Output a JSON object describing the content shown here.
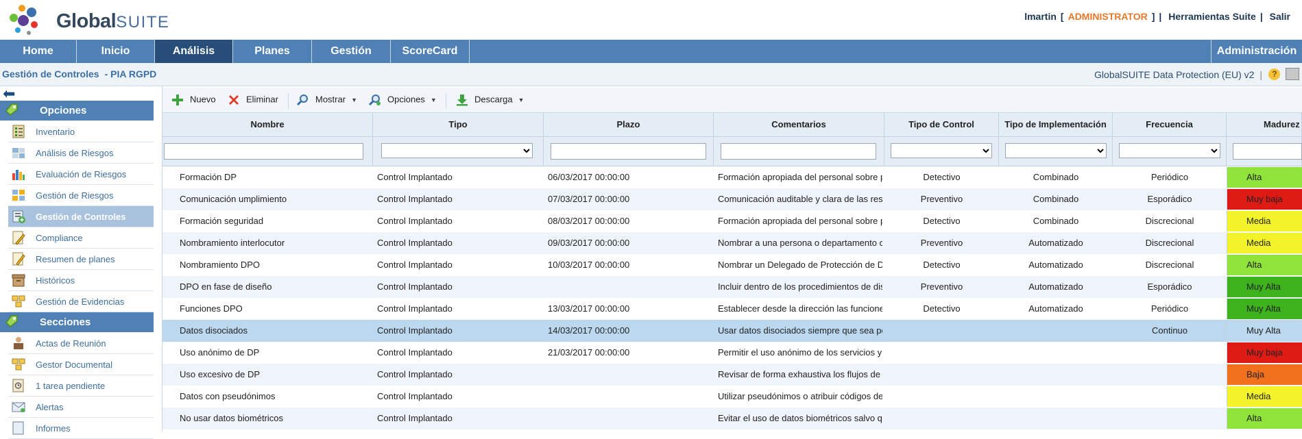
{
  "header": {
    "logo_main": "Global",
    "logo_suite": "SUITE",
    "user": "lmartin",
    "role": "ADMINISTRATOR",
    "tools_label": "Herramientas Suite",
    "exit_label": "Salir"
  },
  "nav": {
    "items": [
      "Home",
      "Inicio",
      "Análisis",
      "Planes",
      "Gestión",
      "ScoreCard"
    ],
    "active": "Análisis",
    "admin": "Administración"
  },
  "subheader": {
    "title": "Gestión de Controles",
    "context": "- PIA RGPD",
    "product": "GlobalSUITE Data Protection (EU) v2",
    "help": "?"
  },
  "sidebar": {
    "opciones_label": "Opciones",
    "opciones_items": [
      "Inventario",
      "Análisis de Riesgos",
      "Evaluación de Riesgos",
      "Gestión de Riesgos",
      "Gestión de Controles",
      "Compliance",
      "Resumen de planes",
      "Históricos",
      "Gestión de Evidencias"
    ],
    "active_item": "Gestión de Controles",
    "secciones_label": "Secciones",
    "secciones_items": [
      "Actas de Reunión",
      "Gestor Documental",
      "1 tarea pendiente",
      "Alertas",
      "Informes"
    ]
  },
  "toolbar": {
    "nuevo": "Nuevo",
    "eliminar": "Eliminar",
    "mostrar": "Mostrar",
    "opciones": "Opciones",
    "descarga": "Descarga"
  },
  "table": {
    "columns": [
      "Nombre",
      "Tipo",
      "Plazo",
      "Comentarios",
      "Tipo de Control",
      "Tipo de Implementación",
      "Frecuencia",
      "Madurez"
    ],
    "rows": [
      {
        "nombre": "Formación DP",
        "tipo": "Control Implantado",
        "plazo": "06/03/2017 00:00:00",
        "comentarios": "Formación apropiada del personal sobre p",
        "control": "Detectivo",
        "impl": "Combinado",
        "frecuencia": "Periódico",
        "madurez": "Alta",
        "color": "#8fe33a"
      },
      {
        "nombre": "Comunicación umplimiento",
        "tipo": "Control Implantado",
        "plazo": "07/03/2017 00:00:00",
        "comentarios": "Comunicación auditable y clara de las res",
        "control": "Preventivo",
        "impl": "Combinado",
        "frecuencia": "Esporádico",
        "madurez": "Muy baja",
        "color": "#dd1b14"
      },
      {
        "nombre": "Formación seguridad",
        "tipo": "Control Implantado",
        "plazo": "08/03/2017 00:00:00",
        "comentarios": "Formación apropiada del personal sobre p",
        "control": "Detectivo",
        "impl": "Combinado",
        "frecuencia": "Discrecional",
        "madurez": "Media",
        "color": "#f3f32a"
      },
      {
        "nombre": "Nombramiento interlocutor",
        "tipo": "Control Implantado",
        "plazo": "09/03/2017 00:00:00",
        "comentarios": "Nombrar a una persona o departamento cc",
        "control": "Preventivo",
        "impl": "Automatizado",
        "frecuencia": "Discrecional",
        "madurez": "Media",
        "color": "#f3f32a"
      },
      {
        "nombre": "Nombramiento DPO",
        "tipo": "Control Implantado",
        "plazo": "10/03/2017 00:00:00",
        "comentarios": "Nombrar un Delegado de Protección de Da",
        "control": "Detectivo",
        "impl": "Automatizado",
        "frecuencia": "Discrecional",
        "madurez": "Alta",
        "color": "#8fe33a"
      },
      {
        "nombre": "DPO en fase de diseño",
        "tipo": "Control Implantado",
        "plazo": "",
        "comentarios": "Incluir dentro de los procedimientos de dis",
        "control": "Preventivo",
        "impl": "Automatizado",
        "frecuencia": "Esporádico",
        "madurez": "Muy Alta",
        "color": "#3cb21c"
      },
      {
        "nombre": "Funciones DPO",
        "tipo": "Control Implantado",
        "plazo": "13/03/2017 00:00:00",
        "comentarios": "Establecer desde la dirección las funcione",
        "control": "Detectivo",
        "impl": "Automatizado",
        "frecuencia": "Periódico",
        "madurez": "Muy Alta",
        "color": "#3cb21c"
      },
      {
        "nombre": "Datos disociados",
        "tipo": "Control Implantado",
        "plazo": "14/03/2017 00:00:00",
        "comentarios": "Usar datos disociados siempre que sea pc",
        "control": "",
        "impl": "",
        "frecuencia": "Continuo",
        "madurez": "Muy Alta",
        "color": ""
      },
      {
        "nombre": "Uso anónimo de DP",
        "tipo": "Control Implantado",
        "plazo": "21/03/2017 00:00:00",
        "comentarios": "Permitir el uso anónimo de los servicios y",
        "control": "",
        "impl": "",
        "frecuencia": "",
        "madurez": "Muy baja",
        "color": "#dd1b14"
      },
      {
        "nombre": "Uso excesivo de DP",
        "tipo": "Control Implantado",
        "plazo": "",
        "comentarios": "Revisar de forma exhaustiva los flujos de ir",
        "control": "",
        "impl": "",
        "frecuencia": "",
        "madurez": "Baja",
        "color": "#f0701e"
      },
      {
        "nombre": "Datos con pseudónimos",
        "tipo": "Control Implantado",
        "plazo": "",
        "comentarios": "Utilizar pseudónimos o atribuir códigos de",
        "control": "",
        "impl": "",
        "frecuencia": "",
        "madurez": "Media",
        "color": "#f3f32a"
      },
      {
        "nombre": "No usar datos biométricos",
        "tipo": "Control Implantado",
        "plazo": "",
        "comentarios": "Evitar el uso de datos biométricos salvo qu",
        "control": "",
        "impl": "",
        "frecuencia": "",
        "madurez": "Alta",
        "color": "#8fe33a"
      }
    ],
    "selected_row": 7
  },
  "colors": {
    "nav": "#4f81b5",
    "nav_active": "#274e78",
    "accent_orange": "#e8792b",
    "header_bg": "#e4ecf5",
    "row_selected": "#bcd8ef"
  }
}
